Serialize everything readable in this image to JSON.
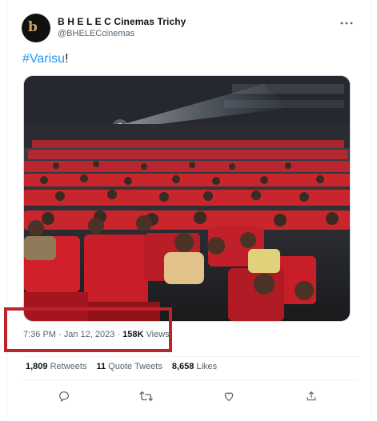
{
  "account": {
    "name": "B H E L E C Cinemas Trichy",
    "handle": "@BHELECcinemas",
    "avatar_letter": "b"
  },
  "tweet": {
    "hashtag": "#Varisu",
    "suffix": "!"
  },
  "meta": {
    "time": "7:36 PM",
    "separator1": " · ",
    "date": "Jan 12, 2023",
    "separator2": " · ",
    "views_count": "158K",
    "views_label": " Views"
  },
  "stats": {
    "retweets_count": "1,809",
    "retweets_label": "Retweets",
    "quotes_count": "11",
    "quotes_label": "Quote Tweets",
    "likes_count": "8,658",
    "likes_label": "Likes"
  },
  "icons": {
    "more": "more-dots-icon",
    "reply": "reply-icon",
    "retweet": "retweet-icon",
    "like": "like-icon",
    "share": "share-icon"
  },
  "colors": {
    "link": "#1d9bf0",
    "secondary_text": "#536471",
    "highlight_box": "#c0242b",
    "seat_red": "#d0202a"
  }
}
